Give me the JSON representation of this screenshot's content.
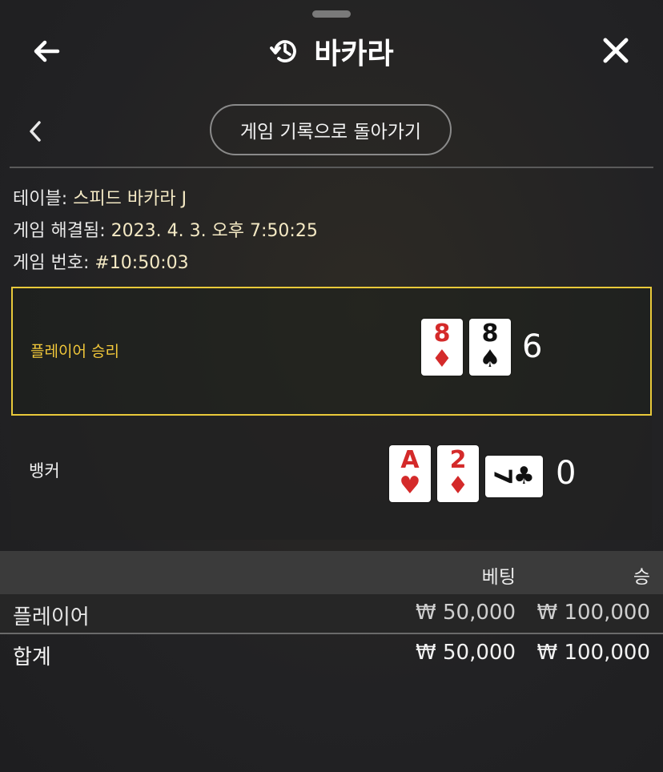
{
  "header": {
    "title": "바카라",
    "back_icon": "arrow-left-icon",
    "history_icon": "history-icon",
    "close_icon": "close-icon"
  },
  "subnav": {
    "back_icon": "chevron-left-icon",
    "history_button_label": "게임 기록으로 돌아가기"
  },
  "info": {
    "table_label": "테이블:",
    "table_value": "스피드 바카라 J",
    "resolved_label": "게임 해결됨:",
    "resolved_value": "2023. 4. 3. 오후 7:50:25",
    "game_no_label": "게임 번호:",
    "game_no_value": "#10:50:03"
  },
  "result": {
    "player_label": "플레이어 승리",
    "player_cards": [
      {
        "rank": "8",
        "suit": "♦",
        "color": "#d42a2a"
      },
      {
        "rank": "8",
        "suit": "♠",
        "color": "#111111"
      }
    ],
    "player_score": "6",
    "banker_label": "뱅커",
    "banker_cards": [
      {
        "rank": "A",
        "suit": "♥",
        "color": "#d42a2a"
      },
      {
        "rank": "2",
        "suit": "♦",
        "color": "#d42a2a"
      },
      {
        "rank": "7",
        "suit": "♣",
        "color": "#111111",
        "sideways": true
      }
    ],
    "banker_score": "0",
    "accent_color": "#e9c93a"
  },
  "table": {
    "col_bet": "베팅",
    "col_win": "승",
    "rows": [
      {
        "name": "플레이어",
        "bet": "₩ 50,000",
        "win": "₩ 100,000"
      }
    ],
    "total": {
      "name": "합계",
      "bet": "₩ 50,000",
      "win": "₩ 100,000"
    }
  }
}
